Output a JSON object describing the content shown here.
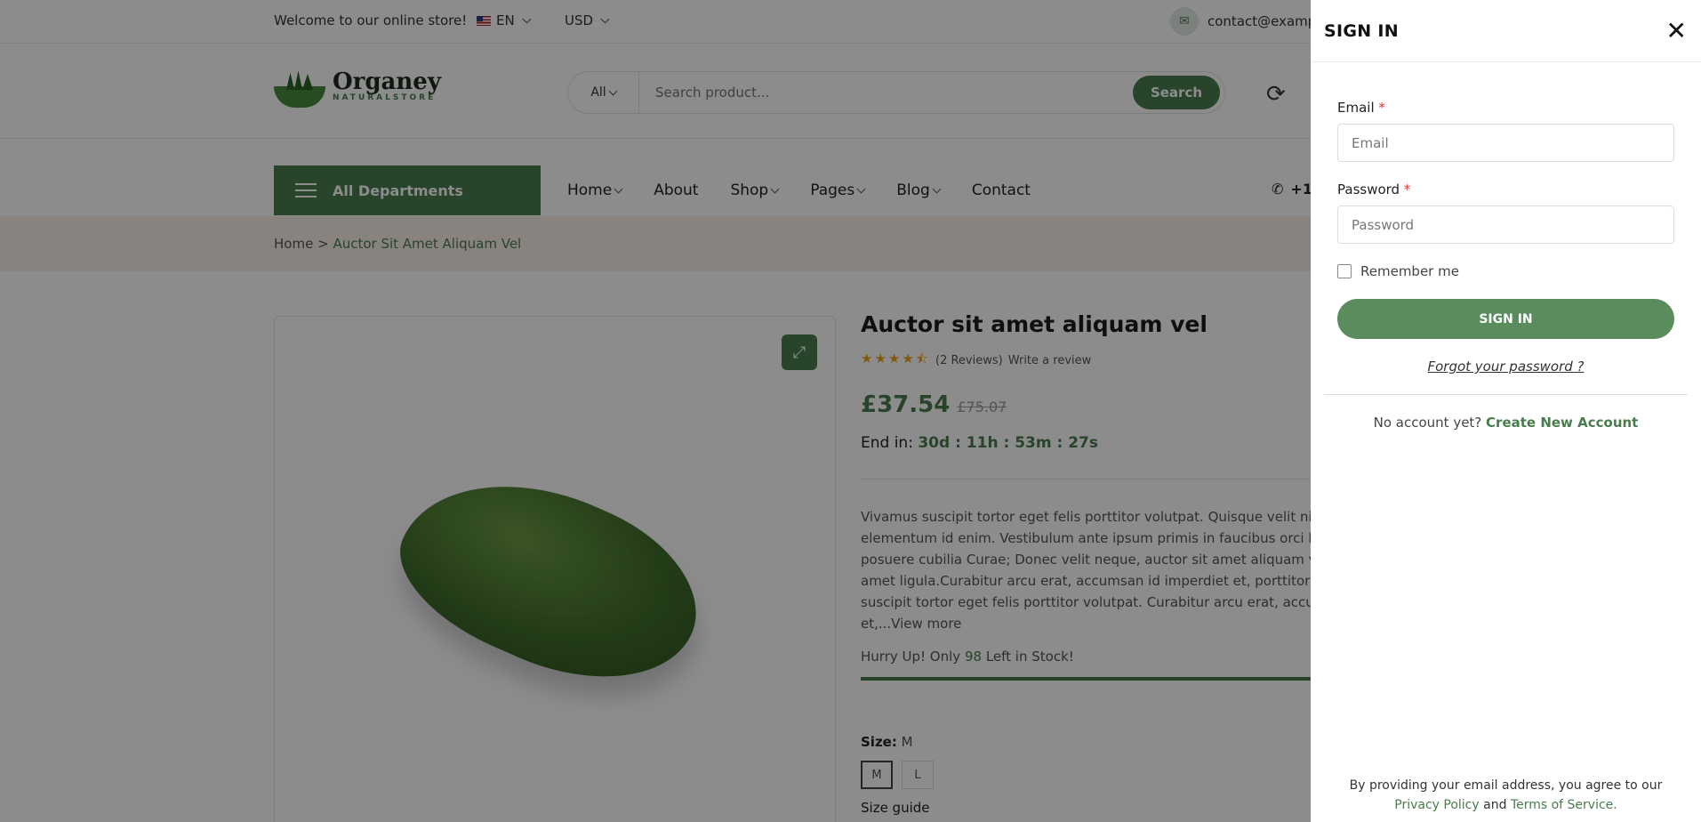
{
  "topbar": {
    "welcome": "Welcome to our online store!",
    "language": "EN",
    "currency": "USD",
    "email": "contact@examp"
  },
  "header": {
    "logo_name": "Organey",
    "logo_sub": "NATURALSTORE",
    "search_category": "All",
    "search_placeholder": "Search product...",
    "search_button": "Search"
  },
  "nav": {
    "departments": "All Departments",
    "items": [
      {
        "label": "Home"
      },
      {
        "label": "About"
      },
      {
        "label": "Shop"
      },
      {
        "label": "Pages"
      },
      {
        "label": "Blog"
      },
      {
        "label": "Contact"
      }
    ],
    "phone": "+1"
  },
  "breadcrumb": {
    "home": "Home",
    "separator": ">",
    "current": "Auctor Sit Amet Aliquam Vel"
  },
  "product": {
    "title": "Auctor sit amet aliquam vel",
    "rating": 4.5,
    "reviews": "(2 Reviews)",
    "write_review": "Write a review",
    "price": "£37.54",
    "old_price": "£75.07",
    "countdown_label": "End in:",
    "countdown_value": "30d : 11h : 53m : 27s",
    "description_lines": [
      "Vivamus suscipit tortor eget felis porttitor volutpat. Quisque velit nisi, pret",
      "elementum id enim. Vestibulum ante ipsum primis in faucibus orci luctus",
      "posuere cubilia Curae; Donec velit neque, auctor sit amet aliquam vel, ul",
      "amet ligula.Curabitur arcu erat, accumsan id imperdiet et, porttitor at se",
      "suscipit tortor eget felis porttitor volutpat. Curabitur arcu erat, accumsar",
      "et,...View more"
    ],
    "stock_pre": "Hurry Up! Only",
    "stock_count": "98",
    "stock_post": "Left in Stock!",
    "stock_fraction": 0.98,
    "size_label": "Size:",
    "size_value": "M",
    "sizes": [
      "M",
      "L"
    ],
    "size_guide": "Size guide"
  },
  "signin": {
    "title": "SIGN IN",
    "email_label": "Email",
    "email_placeholder": "Email",
    "password_label": "Password",
    "password_placeholder": "Password",
    "required_mark": "*",
    "remember": "Remember me",
    "button": "SIGN IN",
    "forgot": "Forgot your password ?",
    "no_account": "No account yet?",
    "create": "Create New Account",
    "terms_line1": "By providing your email address, you agree to our",
    "privacy": "Privacy Policy",
    "and": "and",
    "tos": "Terms of Service."
  },
  "colors": {
    "accent": "#4a7c4e",
    "overlay": "rgba(0,0,0,0.45)",
    "star": "#e8a21a"
  }
}
